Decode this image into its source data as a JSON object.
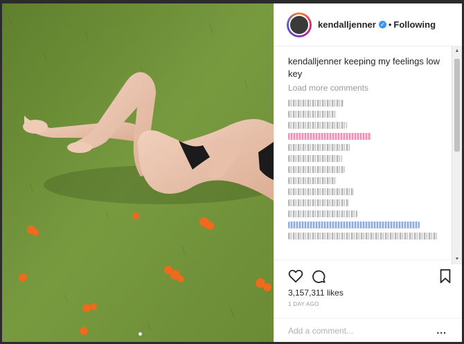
{
  "post": {
    "username": "kendalljenner",
    "bullet": "•",
    "follow_status": "Following",
    "caption_user": "kendalljenner",
    "caption_text": " keeping my feelings low key",
    "load_more": "Load more comments",
    "likes": "3,157,311 likes",
    "timestamp": "1 DAY AGO",
    "comment_placeholder": "Add a comment...",
    "more_options": "..."
  },
  "icons": {
    "verified": "verified-badge-icon",
    "like": "heart-icon",
    "comment": "comment-icon",
    "save": "bookmark-icon",
    "more": "more-options-icon"
  },
  "colors": {
    "accent_blue": "#3897f0",
    "text": "#262626",
    "muted": "#999999",
    "grass": "#6e8f3a"
  }
}
